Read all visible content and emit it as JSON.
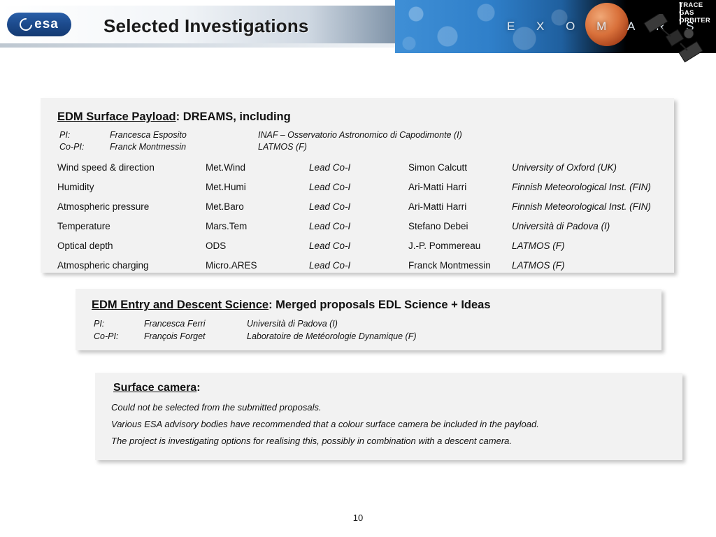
{
  "header": {
    "logo_text": "esa",
    "title": "Selected Investigations",
    "banner_word": "E X O M A R S",
    "tgo_line1": "TRACE",
    "tgo_line2": "GAS",
    "tgo_line3": "ORBITER"
  },
  "payload": {
    "heading_underlined": "EDM Surface Payload",
    "heading_rest": ":  DREAMS, including",
    "pi_label": "PI:",
    "pi_name": "Francesca Esposito",
    "pi_inst": "INAF – Osservatorio Astronomico di Capodimonte (I)",
    "copi_label": "Co-PI:",
    "copi_name": "Franck Montmessin",
    "copi_inst": "LATMOS (F)",
    "rows": [
      {
        "name": "Wind speed & direction",
        "short": "Met.Wind",
        "role": "Lead Co-I",
        "lead": "Simon Calcutt",
        "inst": "University of Oxford (UK)"
      },
      {
        "name": "Humidity",
        "short": "Met.Humi",
        "role": "Lead Co-I",
        "lead": "Ari-Matti Harri",
        "inst": "Finnish Meteorological Inst. (FIN)"
      },
      {
        "name": "Atmospheric pressure",
        "short": "Met.Baro",
        "role": "Lead Co-I",
        "lead": "Ari-Matti Harri",
        "inst": "Finnish Meteorological Inst. (FIN)"
      },
      {
        "name": "Temperature",
        "short": "Mars.Tem",
        "role": "Lead Co-I",
        "lead": "Stefano Debei",
        "inst": "Università di Padova (I)"
      },
      {
        "name": "Optical depth",
        "short": "ODS",
        "role": "Lead Co-I",
        "lead": "J.-P. Pommereau",
        "inst": "LATMOS (F)"
      },
      {
        "name": "Atmospheric charging",
        "short": "Micro.ARES",
        "role": "Lead Co-I",
        "lead": "Franck Montmessin",
        "inst": "LATMOS (F)"
      }
    ]
  },
  "edl": {
    "heading_underlined": "EDM Entry and Descent Science",
    "heading_rest": ":  Merged proposals EDL Science + Ideas",
    "pi_label": "PI:",
    "pi_name": "Francesca Ferri",
    "pi_inst": "Università di Padova (I)",
    "copi_label": "Co-PI:",
    "copi_name": "François Forget",
    "copi_inst": "Laboratoire de Metéorologie Dynamique (F)"
  },
  "camera": {
    "heading_underlined": "Surface camera",
    "heading_rest": ":",
    "lines": [
      "Could not be selected from the submitted proposals.",
      "Various ESA advisory bodies have recommended that a colour surface camera be included in the payload.",
      "The project is investigating options for realising this, possibly in combination with a descent camera."
    ]
  },
  "footer": {
    "page_number": "10"
  }
}
